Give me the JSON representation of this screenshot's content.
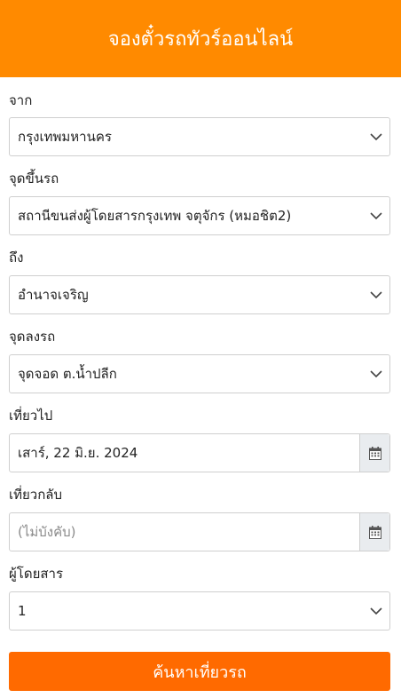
{
  "header": {
    "title": "จองตั๋วรถทัวร์ออนไลน์"
  },
  "form": {
    "origin": {
      "label": "จาก",
      "value": "กรุงเทพมหานคร"
    },
    "pickup": {
      "label": "จุดขึ้นรถ",
      "value": "สถานีขนส่งผู้โดยสารกรุงเทพ จตุจักร (หมอชิต2)"
    },
    "destination": {
      "label": "ถึง",
      "value": "อำนาจเจริญ"
    },
    "dropoff": {
      "label": "จุดลงรถ",
      "value": "จุดจอด ต.น้ำปลีก"
    },
    "depart": {
      "label": "เที่ยวไป",
      "value": "เสาร์, 22 มิ.ย. 2024"
    },
    "return": {
      "label": "เที่ยวกลับ",
      "placeholder": "(ไม่บังคับ)"
    },
    "passengers": {
      "label": "ผู้โดยสาร",
      "value": "1"
    },
    "search_label": "ค้นหาเที่ยวรถ"
  },
  "icons": {
    "dropdown": "chevron-down-icon",
    "calendar": "calendar-icon"
  },
  "colors": {
    "header": "#ff8a00",
    "button": "#ff6a00"
  }
}
